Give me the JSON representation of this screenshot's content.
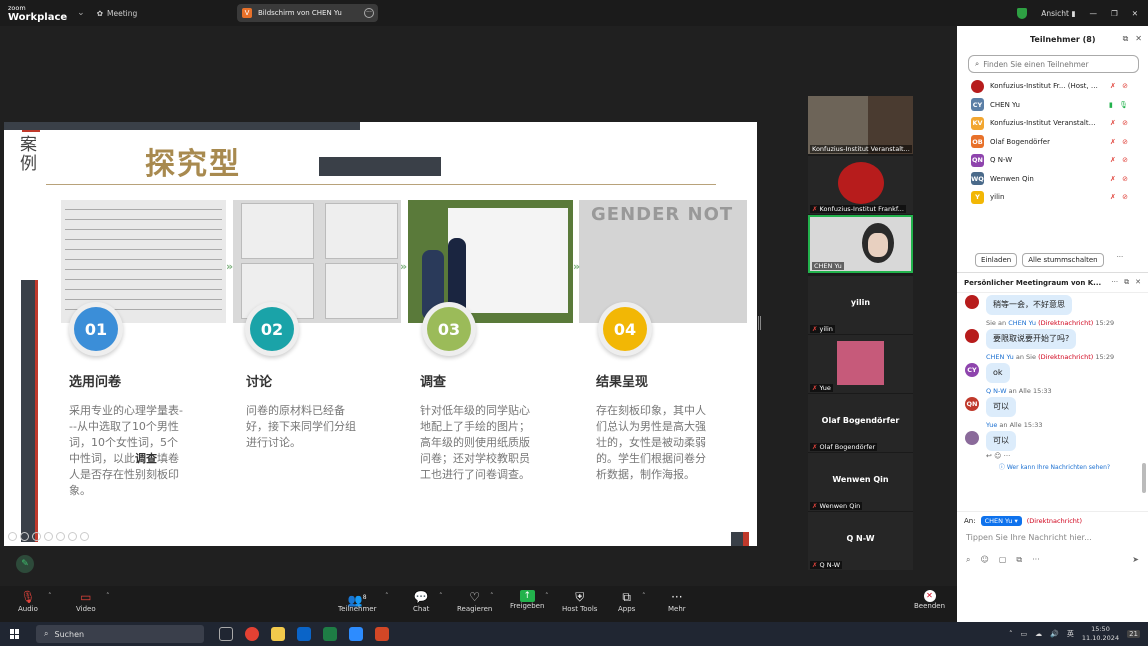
{
  "app": {
    "logo_line1": "zoom",
    "logo_line2": "Workplace",
    "meeting_label": "Meeting",
    "share_label": "Bildschirm von CHEN Yu",
    "view_label": "Ansicht"
  },
  "slide": {
    "case_label": "案例",
    "title": "探究型",
    "steps": [
      {
        "num": "01",
        "color": "#3b8ed8",
        "heading": "选用问卷",
        "text_pre": "采用专业的心理学量表---从中选取了10个男性词，10个女性词，5个中性词，以此",
        "text_bold": "调查",
        "text_post": "填卷人是否存在性别刻板印象。"
      },
      {
        "num": "02",
        "color": "#1aa3a8",
        "heading": "讨论",
        "text_pre": "问卷的原材料已经备好，接下来同学们分组进行讨论。",
        "text_bold": "",
        "text_post": ""
      },
      {
        "num": "03",
        "color": "#9bbb59",
        "heading": "调查",
        "text_pre": "针对低年级的同学贴心地配上了手绘的图片；高年级的则使用纸质版问卷；还对学校教职员工也进行了问卷调查。",
        "text_bold": "",
        "text_post": ""
      },
      {
        "num": "04",
        "color": "#f2b705",
        "heading": "结果呈现",
        "text_pre": "存在刻板印象，其中人们总认为男性是高大强壮的，女性是被动柔弱的。学生们根据问卷分析数据，制作海报。",
        "text_bold": "",
        "text_post": ""
      }
    ],
    "photo4_text": "GENDER NOT"
  },
  "tiles": [
    {
      "name": "Konfuzius-Institut Veranstalt..."
    },
    {
      "name": "Konfuzius-Institut Frankf..."
    },
    {
      "name": "CHEN Yu"
    },
    {
      "center": "yilin",
      "name": "yilin"
    },
    {
      "name": "Yue"
    },
    {
      "center": "Olaf Bogendörfer",
      "name": "Olaf Bogendörfer"
    },
    {
      "center": "Wenwen Qin",
      "name": "Wenwen Qin"
    },
    {
      "center": "Q N-W",
      "name": "Q N-W"
    }
  ],
  "toolbar": {
    "audio": "Audio",
    "video": "Video",
    "participants": "Teilnehmer",
    "participants_count": "8",
    "chat": "Chat",
    "react": "Reagieren",
    "share": "Freigeben",
    "host_tools": "Host Tools",
    "apps": "Apps",
    "more": "Mehr",
    "end": "Beenden"
  },
  "participants": {
    "title": "Teilnehmer (8)",
    "search_placeholder": "Finden Sie einen Teilnehmer",
    "list": [
      {
        "initials": "",
        "color": "#b71c1c",
        "name": "Konfuzius-Institut Fr... (Host, ich)"
      },
      {
        "initials": "CY",
        "color": "#5b7fa6",
        "name": "CHEN Yu"
      },
      {
        "initials": "KV",
        "color": "#f2a630",
        "name": "Konfuzius-Institut Veranstaltung..."
      },
      {
        "initials": "OB",
        "color": "#e8712a",
        "name": "Olaf Bogendörfer"
      },
      {
        "initials": "QN",
        "color": "#8e44ad",
        "name": "Q N-W"
      },
      {
        "initials": "WQ",
        "color": "#4a6a8a",
        "name": "Wenwen Qin"
      },
      {
        "initials": "Y",
        "color": "#f2b705",
        "name": "yilin"
      }
    ],
    "invite": "Einladen",
    "mute_all": "Alle stummschalten"
  },
  "chat": {
    "title": "Persönlicher Meetingraum von K...",
    "messages": [
      {
        "meta_from": "",
        "meta_mid": "",
        "meta_to": "",
        "meta_dm": "",
        "time": "",
        "avatar": "",
        "color": "#b71c1c",
        "text": "稍等一会，不好意思"
      },
      {
        "meta_from": "Sie an",
        "meta_mid": "CHEN Yu",
        "meta_to": "",
        "meta_dm": "(Direktnachricht)",
        "time": "15:29",
        "avatar": "",
        "color": "#b71c1c",
        "text": "要限取说要开始了吗?"
      },
      {
        "meta_from": "CHEN Yu",
        "meta_mid": "an Sie",
        "meta_to": "",
        "meta_dm": "(Direktnachricht)",
        "time": "15:29",
        "avatar": "CY",
        "color": "#8e44ad",
        "text": "ok"
      },
      {
        "meta_from": "Q N-W",
        "meta_mid": "an Alle",
        "meta_to": "",
        "meta_dm": "",
        "time": "15:33",
        "avatar": "QN",
        "color": "#c0392b",
        "text": "可以"
      },
      {
        "meta_from": "Yue",
        "meta_mid": "an Alle",
        "meta_to": "",
        "meta_dm": "",
        "time": "15:33",
        "avatar": "",
        "color": "#8a6a9a",
        "text": "可以"
      }
    ],
    "seen": "Wer kann Ihre Nachrichten sehen?",
    "to_label": "An:",
    "to_value": "CHEN Yu ▾",
    "to_dm": "(Direktnachricht)",
    "input_placeholder": "Tippen Sie Ihre Nachricht hier..."
  },
  "taskbar": {
    "search": "Suchen",
    "lang": "英",
    "time": "15:50",
    "date": "11.10.2024",
    "badge": "21"
  }
}
